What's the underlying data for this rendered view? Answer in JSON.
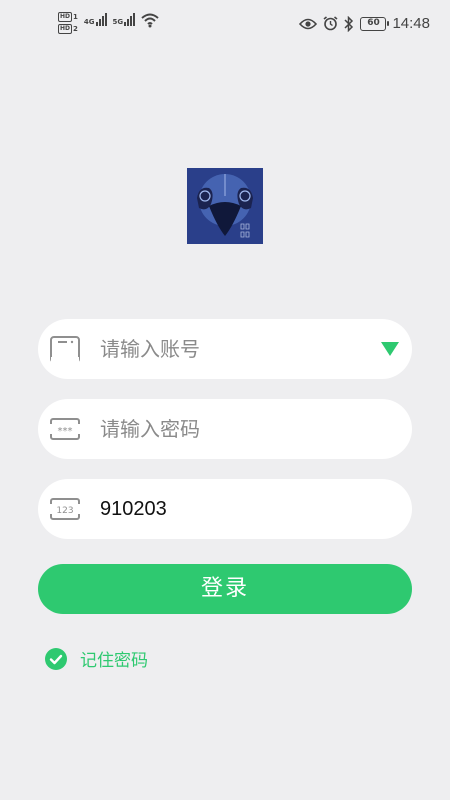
{
  "status_bar": {
    "sim1_label": "HD",
    "sim1_index": "1",
    "sim2_label": "HD",
    "sim2_index": "2",
    "net1": "4G",
    "net2": "5G",
    "battery": "60",
    "time": "14:48",
    "icons": [
      "eye-icon",
      "alarm-icon",
      "bluetooth-icon",
      "wifi-icon"
    ]
  },
  "login": {
    "account_placeholder": "请输入账号",
    "password_placeholder": "请输入密码",
    "captcha_value": "910203",
    "captcha_icon_text": "123",
    "password_icon_text": "***",
    "login_label": "登录",
    "remember_label": "记住密码",
    "remember_checked": true
  },
  "colors": {
    "accent": "#2ec970",
    "background": "#eeeef0",
    "field": "#ffffff",
    "placeholder": "#8a8a8a"
  }
}
